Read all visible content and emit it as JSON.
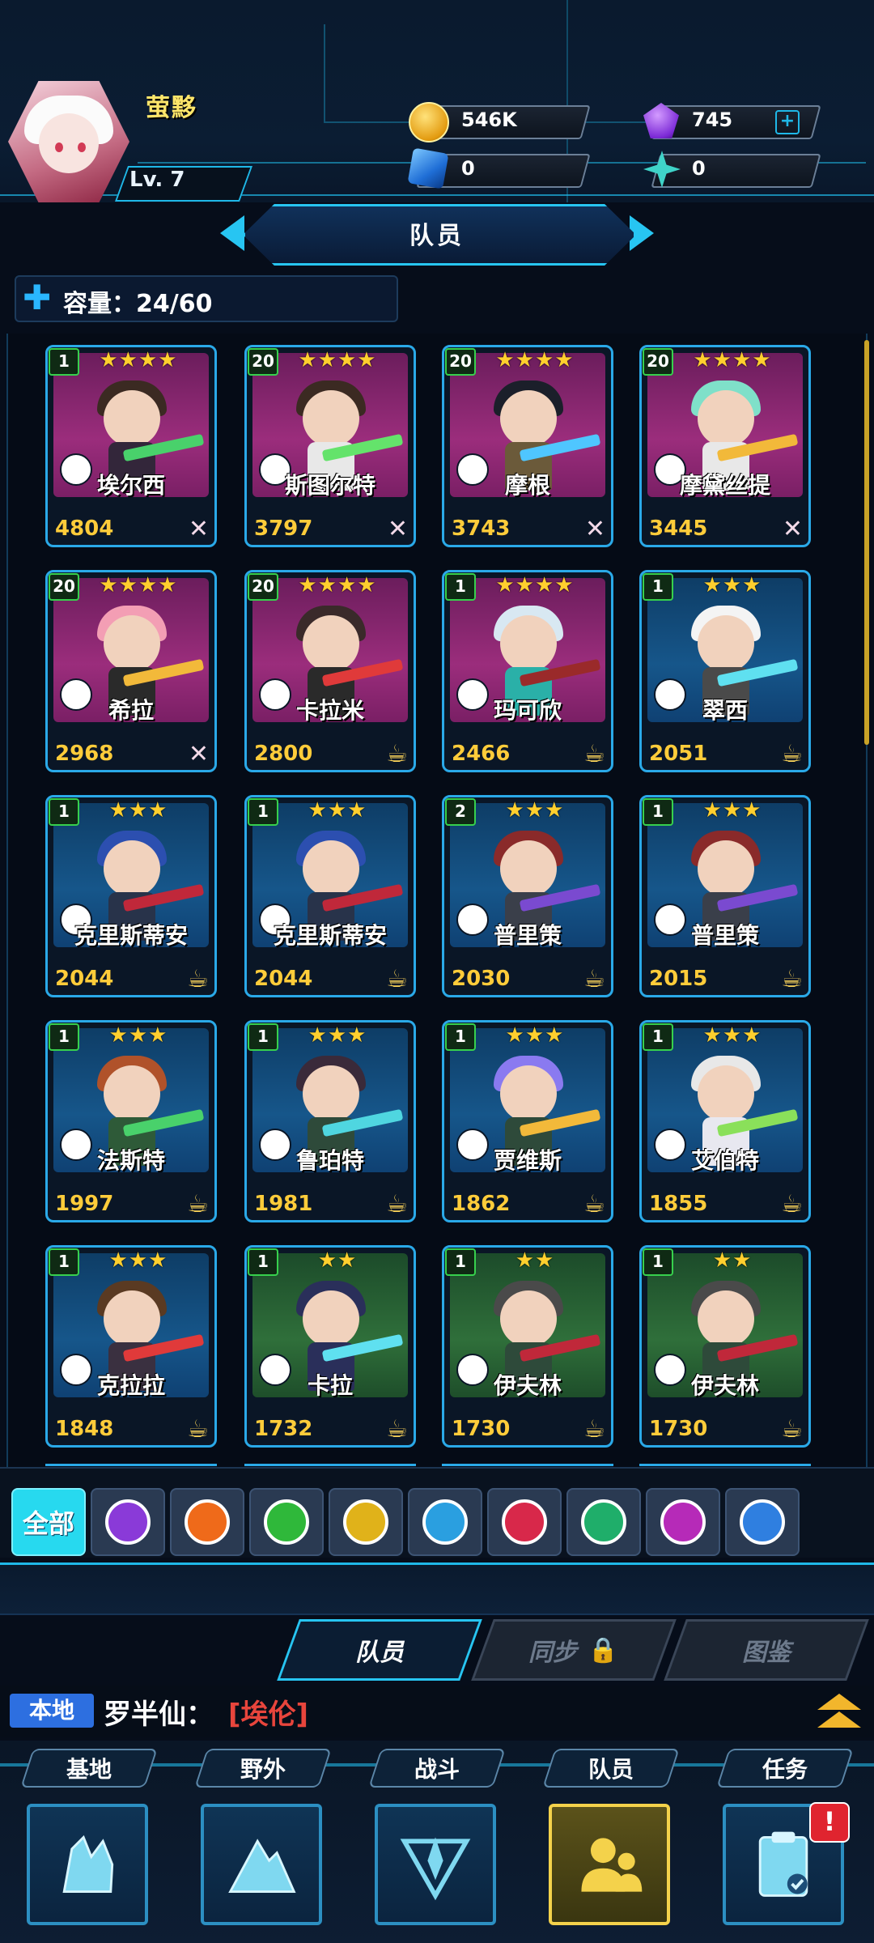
{
  "player": {
    "name": "萤黟",
    "level": "Lv. 7"
  },
  "resources": {
    "gold": "546K",
    "gems": "745",
    "cubes": "0",
    "shards": "0"
  },
  "page_title": "队员",
  "capacity": "容量：24/60",
  "cards": [
    {
      "level": "1",
      "stars": "★★★★",
      "name": "埃尔西",
      "power": "4804",
      "status": "✕",
      "theme": "purple",
      "role": "△",
      "hair": "#3b2a22",
      "outfit": "#33263a",
      "weapon": "#49d16b"
    },
    {
      "level": "20",
      "stars": "★★★★",
      "name": "斯图尔特",
      "power": "3797",
      "status": "✕",
      "theme": "purple",
      "role": "✚",
      "hair": "#3b2a22",
      "outfit": "#e8e8e8",
      "weapon": "#64e36b"
    },
    {
      "level": "20",
      "stars": "★★★★",
      "name": "摩根",
      "power": "3743",
      "status": "✕",
      "theme": "purple",
      "role": "▮",
      "hair": "#1b1f2a",
      "outfit": "#6b5a3a",
      "weapon": "#4fc6ff"
    },
    {
      "level": "20",
      "stars": "★★★★",
      "name": "摩黛丝提",
      "power": "3445",
      "status": "✕",
      "theme": "purple",
      "role": "◆",
      "hair": "#7fe0c9",
      "outfit": "#e8e8e8",
      "weapon": "#f2b93a"
    },
    {
      "level": "20",
      "stars": "★★★★",
      "name": "希拉",
      "power": "2968",
      "status": "✕",
      "theme": "purple",
      "role": "◆",
      "hair": "#f39eb4",
      "outfit": "#2a2a2a",
      "weapon": "#f2b93a"
    },
    {
      "level": "20",
      "stars": "★★★★",
      "name": "卡拉米",
      "power": "2800",
      "status": "☕",
      "theme": "purple",
      "role": "▬",
      "hair": "#3a2a2a",
      "outfit": "#2a2a2a",
      "weapon": "#e03a3a"
    },
    {
      "level": "1",
      "stars": "★★★★",
      "name": "玛可欣",
      "power": "2466",
      "status": "☕",
      "theme": "purple",
      "role": "●",
      "hair": "#d8e8f2",
      "outfit": "#2ab0a8",
      "weapon": "#9a2a2a"
    },
    {
      "level": "1",
      "stars": "★★★",
      "name": "翠西",
      "power": "2051",
      "status": "☕",
      "theme": "blue",
      "role": "▮",
      "hair": "#f4f4f4",
      "outfit": "#4a4a4a",
      "weapon": "#5fe0f0"
    },
    {
      "level": "1",
      "stars": "★★★",
      "name": "克里斯蒂安",
      "power": "2044",
      "status": "☕",
      "theme": "blue",
      "role": "●",
      "hair": "#2c4fb0",
      "outfit": "#28334a",
      "weapon": "#c0283a"
    },
    {
      "level": "1",
      "stars": "★★★",
      "name": "克里斯蒂安",
      "power": "2044",
      "status": "☕",
      "theme": "blue",
      "role": "●",
      "hair": "#2c4fb0",
      "outfit": "#28334a",
      "weapon": "#c0283a"
    },
    {
      "level": "2",
      "stars": "★★★",
      "name": "普里策",
      "power": "2030",
      "status": "☕",
      "theme": "blue",
      "role": "◎",
      "hair": "#8a2a2a",
      "outfit": "#3a3f4a",
      "weapon": "#7a4ad0"
    },
    {
      "level": "1",
      "stars": "★★★",
      "name": "普里策",
      "power": "2015",
      "status": "☕",
      "theme": "blue",
      "role": "◎",
      "hair": "#8a2a2a",
      "outfit": "#3a3f4a",
      "weapon": "#7a4ad0"
    },
    {
      "level": "1",
      "stars": "★★★",
      "name": "法斯特",
      "power": "1997",
      "status": "☕",
      "theme": "blue",
      "role": "△",
      "hair": "#b0522a",
      "outfit": "#2e5a38",
      "weapon": "#49d16b"
    },
    {
      "level": "1",
      "stars": "★★★",
      "name": "鲁珀特",
      "power": "1981",
      "status": "☕",
      "theme": "blue",
      "role": "▲",
      "hair": "#3a2a3a",
      "outfit": "#2e4a3a",
      "weapon": "#4fd6e0"
    },
    {
      "level": "1",
      "stars": "★★★",
      "name": "贾维斯",
      "power": "1862",
      "status": "☕",
      "theme": "blue",
      "role": "◆",
      "hair": "#8a7af0",
      "outfit": "#2e4a3a",
      "weapon": "#f2b93a"
    },
    {
      "level": "1",
      "stars": "★★★",
      "name": "艾伯特",
      "power": "1855",
      "status": "☕",
      "theme": "blue",
      "role": "✚",
      "hair": "#e8e8e8",
      "outfit": "#e8e8f0",
      "weapon": "#8ae05a"
    },
    {
      "level": "1",
      "stars": "★★★",
      "name": "克拉拉",
      "power": "1848",
      "status": "☕",
      "theme": "blue",
      "role": "✖",
      "hair": "#5a3a22",
      "outfit": "#3a3040",
      "weapon": "#e03a3a"
    },
    {
      "level": "1",
      "stars": "★★",
      "name": "卡拉",
      "power": "1732",
      "status": "☕",
      "theme": "green",
      "role": "▮",
      "hair": "#2a2f5a",
      "outfit": "#2a2f5a",
      "weapon": "#5fe0f0"
    },
    {
      "level": "1",
      "stars": "★★",
      "name": "伊夫林",
      "power": "1730",
      "status": "☕",
      "theme": "green",
      "role": "●",
      "hair": "#4a4a4a",
      "outfit": "#2e4a3a",
      "weapon": "#c0283a"
    },
    {
      "level": "1",
      "stars": "★★",
      "name": "伊夫林",
      "power": "1730",
      "status": "☕",
      "theme": "green",
      "role": "●",
      "hair": "#4a4a4a",
      "outfit": "#2e4a3a",
      "weapon": "#c0283a"
    }
  ],
  "filters": {
    "all_label": "全部",
    "items": [
      {
        "name": "filter-shield-icon",
        "color": "#8a3ad8"
      },
      {
        "name": "filter-pistol-icon",
        "color": "#ef6a1a"
      },
      {
        "name": "filter-syringe-icon",
        "color": "#2fb83a"
      },
      {
        "name": "filter-cone-icon",
        "color": "#e0b21a"
      },
      {
        "name": "filter-rocket-icon",
        "color": "#2a9fe0"
      },
      {
        "name": "filter-canister-icon",
        "color": "#d8284a"
      },
      {
        "name": "filter-wrench-icon",
        "color": "#1fae6a"
      },
      {
        "name": "filter-robot-icon",
        "color": "#b62ab8"
      },
      {
        "name": "filter-gasmask-icon",
        "color": "#2f7fe0"
      }
    ]
  },
  "tabs": {
    "members": "队员",
    "sync": "同步",
    "codex": "图鉴"
  },
  "chat": {
    "channel": "本地",
    "speaker": "罗半仙：",
    "message": "[埃伦]"
  },
  "nav": {
    "base": "基地",
    "wild": "野外",
    "battle": "战斗",
    "members": "队员",
    "tasks": "任务",
    "badge": "!"
  },
  "colors": {
    "accent": "#27c5f2",
    "gold": "#ffcc3a",
    "active_nav": "#f4d24b"
  }
}
